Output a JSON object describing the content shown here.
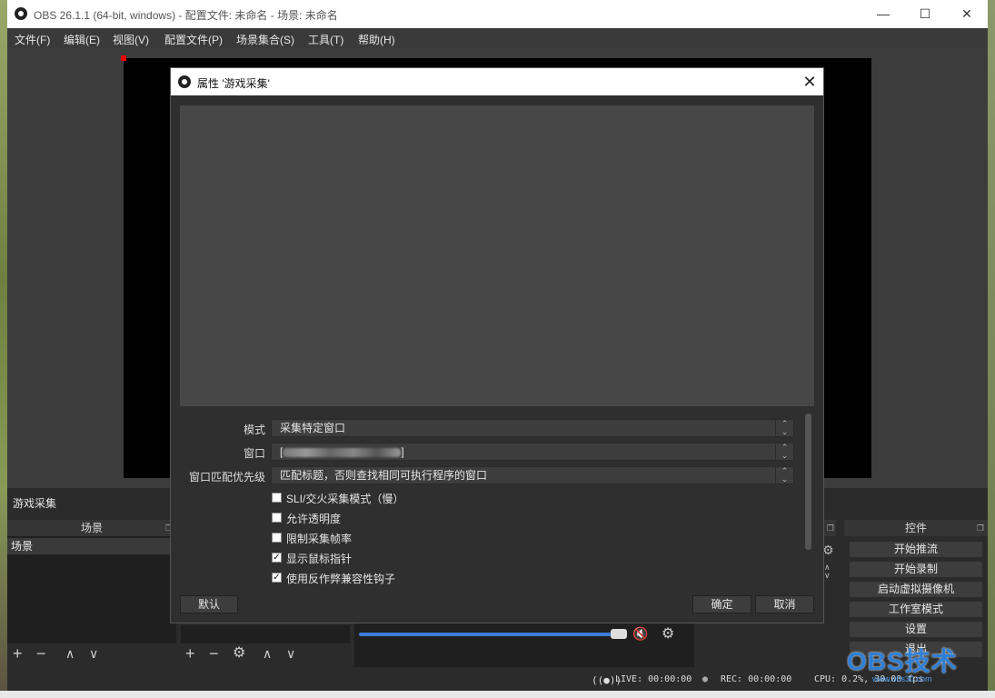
{
  "window": {
    "title": "OBS 26.1.1 (64-bit, windows) - 配置文件: 未命名 - 场景: 未命名",
    "minimize": "—",
    "maximize": "☐",
    "close": "✕"
  },
  "menu": [
    "文件(F)",
    "编辑(E)",
    "视图(V)",
    "配置文件(P)",
    "场景集合(S)",
    "工具(T)",
    "帮助(H)"
  ],
  "source_bar": {
    "current_source": "游戏采集"
  },
  "docks": {
    "scenes": {
      "title": "场景",
      "items": [
        "场景"
      ]
    },
    "controls": {
      "title": "控件",
      "buttons": [
        "开始推流",
        "开始录制",
        "启动虚拟摄像机",
        "工作室模式",
        "设置",
        "退出"
      ]
    }
  },
  "toolbar": {
    "add": "+",
    "remove": "−",
    "up": "∧",
    "down": "∨",
    "gear": "⚙"
  },
  "status": {
    "live": "LIVE: 00:00:00",
    "rec": "REC: 00:00:00",
    "cpu": "CPU: 0.2%, 30.00 fps"
  },
  "mixer": {
    "volume_fraction": 0.97,
    "muted": true
  },
  "dialog": {
    "title": "属性 '游戏采集'",
    "properties": [
      {
        "label": "模式",
        "value": "采集特定窗口"
      },
      {
        "label": "窗口",
        "value": "[",
        "value_suffix": "]"
      },
      {
        "label": "窗口匹配优先级",
        "value": "匹配标题，否则查找相同可执行程序的窗口"
      }
    ],
    "checkboxes": [
      {
        "label": "SLI/交火采集模式（慢）",
        "checked": false
      },
      {
        "label": "允许透明度",
        "checked": false
      },
      {
        "label": "限制采集帧率",
        "checked": false
      },
      {
        "label": "显示鼠标指针",
        "checked": true
      },
      {
        "label": "使用反作弊兼容性钩子",
        "checked": true
      }
    ],
    "buttons": {
      "defaults": "默认",
      "ok": "确定",
      "cancel": "取消"
    }
  },
  "watermark": {
    "text": "OBS技术",
    "sub": "www.obs30.com"
  }
}
